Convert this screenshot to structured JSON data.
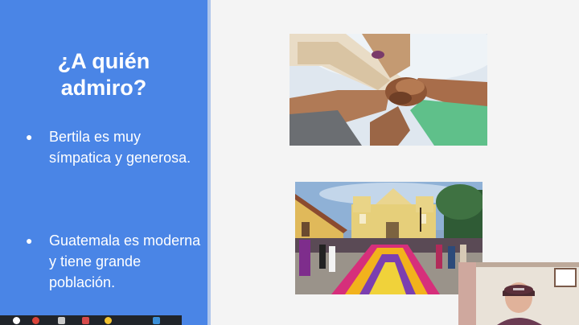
{
  "slide": {
    "title": "¿A quién admiro?",
    "bullets": [
      {
        "marker": "●",
        "text": "Bertila es muy símpatica y generosa."
      },
      {
        "marker": "●",
        "text": "Guatemala es moderna y tiene grande población."
      }
    ],
    "images": [
      {
        "name": "hands-together-photo"
      },
      {
        "name": "antigua-guatemala-photo"
      }
    ],
    "colors": {
      "panel": "#4a85e6",
      "background": "#f4f4f4",
      "text": "#ffffff"
    }
  },
  "webcam": {
    "name": "presenter-webcam"
  },
  "taskbar": {
    "icons": [
      "pause-icon",
      "record-icon",
      "pen-icon",
      "eraser-icon",
      "highlighter-icon",
      "screen-icon"
    ]
  }
}
